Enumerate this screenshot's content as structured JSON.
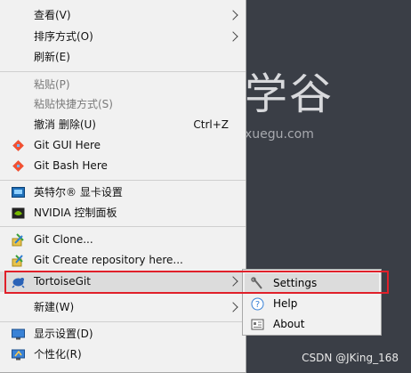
{
  "desktop": {
    "brand_text": "学谷",
    "brand_url": "xuegu.com",
    "watermark": "CSDN @JKing_168"
  },
  "context_menu": {
    "items": [
      {
        "label": "查看(V)",
        "submenu": true
      },
      {
        "label": "排序方式(O)",
        "submenu": true
      },
      {
        "label": "刷新(E)"
      },
      {
        "label": "粘贴(P)",
        "disabled": true
      },
      {
        "label": "粘贴快捷方式(S)",
        "disabled": true
      },
      {
        "label": "撤消 删除(U)",
        "shortcut": "Ctrl+Z"
      },
      {
        "label": "Git GUI Here",
        "icon": "git-gui-icon"
      },
      {
        "label": "Git Bash Here",
        "icon": "git-bash-icon"
      },
      {
        "label": "英特尔® 显卡设置",
        "icon": "intel-graphics-icon"
      },
      {
        "label": "NVIDIA 控制面板",
        "icon": "nvidia-icon"
      },
      {
        "label": "Git Clone...",
        "icon": "git-clone-icon"
      },
      {
        "label": "Git Create repository here...",
        "icon": "git-create-repo-icon"
      },
      {
        "label": "TortoiseGit",
        "icon": "tortoisegit-icon",
        "submenu": true,
        "highlighted": true
      },
      {
        "label": "新建(W)",
        "submenu": true
      },
      {
        "label": "显示设置(D)",
        "icon": "display-settings-icon"
      },
      {
        "label": "个性化(R)",
        "icon": "personalize-icon"
      }
    ]
  },
  "tortoisegit_submenu": {
    "items": [
      {
        "label": "Settings",
        "icon": "settings-wrench-icon",
        "highlighted": true
      },
      {
        "label": "Help",
        "icon": "help-icon"
      },
      {
        "label": "About",
        "icon": "about-icon"
      }
    ]
  },
  "colors": {
    "menu_bg": "#f1f1f1",
    "highlight_bg": "#dcdcdc",
    "annotation_red": "#e0202a",
    "desktop_bg": "#3a3e46"
  }
}
